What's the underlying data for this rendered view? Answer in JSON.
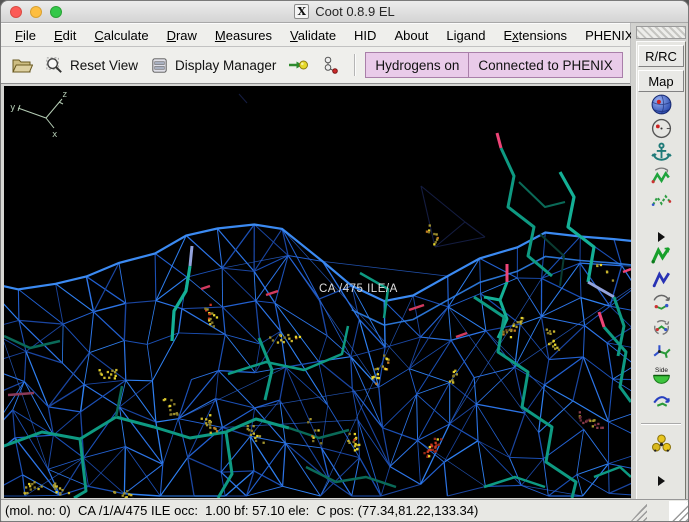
{
  "window": {
    "title": "Coot 0.8.9 EL",
    "controls": [
      "close",
      "minimize",
      "zoom"
    ]
  },
  "menu_bar": {
    "items": [
      {
        "label": "File",
        "mnemonic": 0
      },
      {
        "label": "Edit",
        "mnemonic": 0
      },
      {
        "label": "Calculate",
        "mnemonic": 0
      },
      {
        "label": "Draw",
        "mnemonic": 0
      },
      {
        "label": "Measures",
        "mnemonic": 0
      },
      {
        "label": "Validate",
        "mnemonic": 0
      },
      {
        "label": "HID",
        "mnemonic": -1
      },
      {
        "label": "About",
        "mnemonic": -1
      },
      {
        "label": "Ligand",
        "mnemonic": -1
      },
      {
        "label": "Extensions",
        "mnemonic": 1
      },
      {
        "label": "PHENIX",
        "mnemonic": -1
      }
    ]
  },
  "toolbar": {
    "reset_view_label": "Reset View",
    "display_manager_label": "Display Manager",
    "badges": [
      {
        "label": "Hydrogens on"
      },
      {
        "label": "Connected to PHENIX"
      }
    ],
    "badge_bg": "#e9cbe9"
  },
  "sidebar": {
    "buttons": [
      {
        "label": "R/RC"
      },
      {
        "label": "Map"
      }
    ],
    "tools": [
      {
        "name": "sphere-refine"
      },
      {
        "name": "targeted-refine"
      },
      {
        "name": "fixed-atoms"
      },
      {
        "name": "real-space-refine-zone"
      },
      {
        "name": "regularize-zone"
      },
      {
        "name": "more-tools-expander"
      },
      {
        "name": "auto-fit-rotamer"
      },
      {
        "name": "rotamers"
      },
      {
        "name": "rotate-translate-zone"
      },
      {
        "name": "torsion-general"
      },
      {
        "name": "edit-chi-angles"
      },
      {
        "name": "side-chain-180-flip",
        "badge": "Side"
      },
      {
        "name": "jed-flip"
      },
      {
        "name": "separator"
      },
      {
        "name": "mutate-and-autofit"
      },
      {
        "name": "bottom-expander"
      }
    ]
  },
  "scene": {
    "background": "#000000",
    "atom_label": "CA /475 ILE/A",
    "axes": {
      "z": "z",
      "y": "y",
      "x": "x"
    },
    "colors": {
      "mesh": "#2a6fe0",
      "ridge": "#3b8af2",
      "carbon_stick": "#0e9a82",
      "oxygen_pink": "#ee4477",
      "nitrogen_slate": "#93a3dd",
      "dots_yellow": "#e6d42c",
      "dots_olive": "#a5962e",
      "dots_red": "#cc3a22",
      "axes_green": "#b4ccb4"
    }
  },
  "status_bar": {
    "text": "(mol. no: 0)  CA /1/A/475 ILE occ:  1.00 bf: 57.10 ele:  C pos: (77.34,81.22,133.34)"
  }
}
